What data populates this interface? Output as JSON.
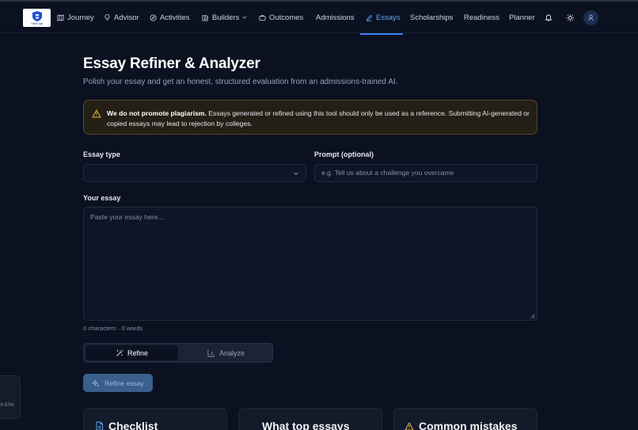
{
  "nav": {
    "logo_text": "PathForge",
    "items": [
      {
        "label": "Journey",
        "icon": "map-icon"
      },
      {
        "label": "Advisor",
        "icon": "lightbulb-icon"
      },
      {
        "label": "Activities",
        "icon": "compass-icon"
      },
      {
        "label": "Builders",
        "icon": "edit-doc-icon"
      },
      {
        "label": "Outcomes",
        "icon": "briefcase-icon"
      },
      {
        "label": "Admissions",
        "icon": ""
      },
      {
        "label": "Essays",
        "icon": "pen-icon",
        "active": true
      },
      {
        "label": "Scholarships",
        "icon": ""
      },
      {
        "label": "Readiness",
        "icon": ""
      },
      {
        "label": "Planner",
        "icon": ""
      }
    ],
    "accent": "#3b82f6"
  },
  "page": {
    "title": "Essay Refiner & Analyzer",
    "subtitle": "Polish your essay and get an honest, structured evaluation from an admissions-trained AI."
  },
  "warning": {
    "bold": "We do not promote plagiarism.",
    "text": " Essays generated or refined using this tool should only be used as a reference. Submitting AI-generated or copied essays may lead to rejection by colleges."
  },
  "form": {
    "essay_type_label": "Essay type",
    "essay_type_value": "",
    "prompt_label": "Prompt (optional)",
    "prompt_placeholder": "e.g. Tell us about a challenge you overcame",
    "essay_label": "Your essay",
    "essay_placeholder": "Paste your essay here...",
    "counter": "0 characters · 0 words"
  },
  "mode": {
    "refine_label": "Refine",
    "analyze_label": "Analyze",
    "selected": "Refine"
  },
  "action": {
    "button_label": "Refine essay"
  },
  "cards": [
    {
      "title": "Checklist",
      "icon": "doc-icon"
    },
    {
      "title": "What top essays",
      "icon": ""
    },
    {
      "title": "Common mistakes",
      "icon": "warning-icon"
    }
  ],
  "toast": {
    "text": "h 57m"
  }
}
